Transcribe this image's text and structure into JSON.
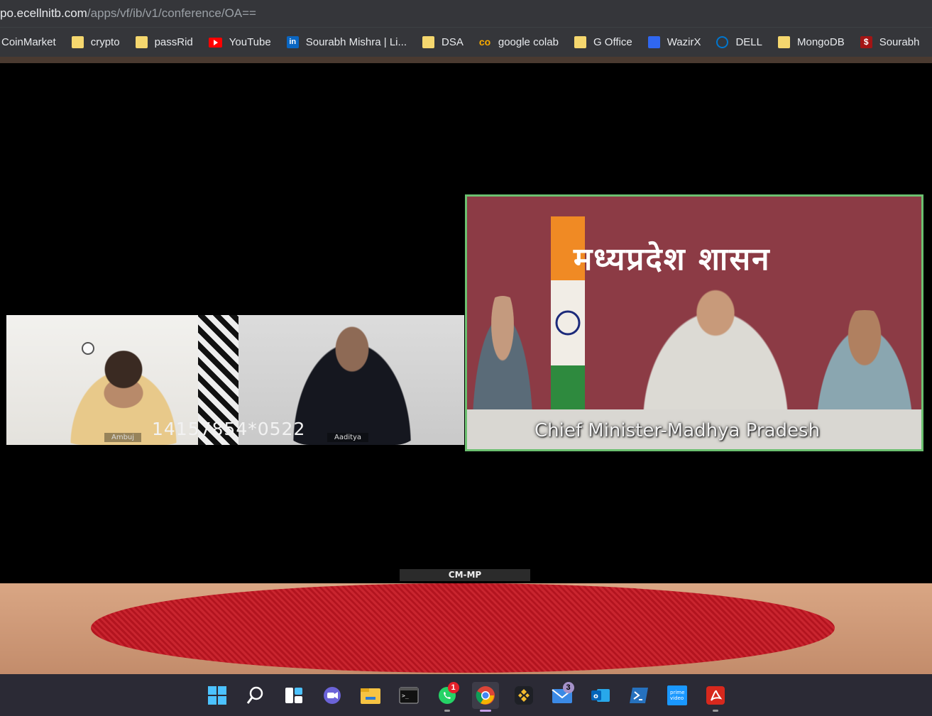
{
  "browser": {
    "url_host": "po.ecellnitb.com",
    "url_path": "/apps/vf/ib/v1/conference/OA=="
  },
  "bookmarks": [
    {
      "label": "CoinMarket",
      "icon": "none"
    },
    {
      "label": "crypto",
      "icon": "folder-icon"
    },
    {
      "label": "passRid",
      "icon": "folder-icon"
    },
    {
      "label": "YouTube",
      "icon": "youtube-icon"
    },
    {
      "label": "Sourabh Mishra | Li...",
      "icon": "linkedin-icon"
    },
    {
      "label": "DSA",
      "icon": "folder-icon"
    },
    {
      "label": "google colab",
      "icon": "colab-icon"
    },
    {
      "label": "G Office",
      "icon": "folder-icon"
    },
    {
      "label": "WazirX",
      "icon": "wazirx-icon"
    },
    {
      "label": "DELL",
      "icon": "dell-icon"
    },
    {
      "label": "MongoDB",
      "icon": "folder-icon"
    },
    {
      "label": "Sourabh",
      "icon": "sourabh-icon"
    }
  ],
  "conference": {
    "participants": [
      {
        "name": "Ambuj"
      },
      {
        "name": "Aaditya"
      }
    ],
    "meeting_code": "14157854*0522",
    "speaker": {
      "banner_text": "मध्यप्रदेश शासन",
      "caption": "Chief Minister-Madhya Pradesh",
      "label": "CM-MP"
    }
  },
  "taskbar": {
    "items": [
      {
        "icon": "windows-start-icon"
      },
      {
        "icon": "search-icon"
      },
      {
        "icon": "widgets-icon"
      },
      {
        "icon": "teams-chat-icon"
      },
      {
        "icon": "file-explorer-icon"
      },
      {
        "icon": "terminal-icon"
      },
      {
        "icon": "whatsapp-icon",
        "badge": "1"
      },
      {
        "icon": "chrome-icon",
        "active": true
      },
      {
        "icon": "binance-icon"
      },
      {
        "icon": "mail-icon",
        "badge": "3"
      },
      {
        "icon": "outlook-icon"
      },
      {
        "icon": "powershell-icon"
      },
      {
        "icon": "prime-video-icon"
      },
      {
        "icon": "acrobat-icon"
      }
    ]
  },
  "colors": {
    "chrome_bar": "#35363a",
    "taskbar": "#2b2a35",
    "active_speaker_border": "#6cc070",
    "rug": "#b3141f"
  }
}
